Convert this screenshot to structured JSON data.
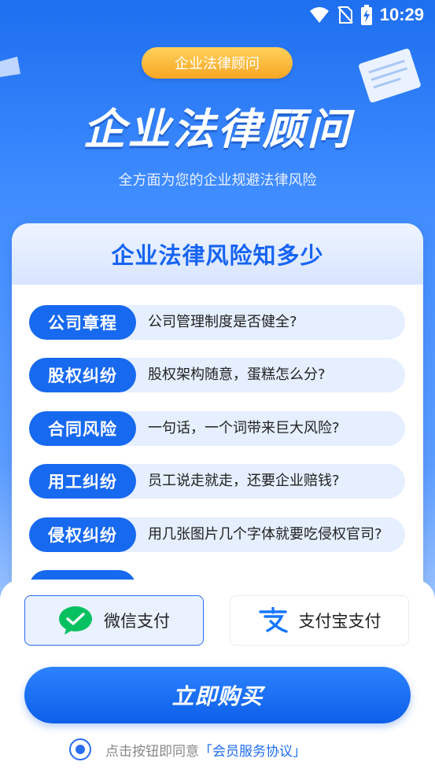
{
  "status": {
    "time": "10:29"
  },
  "header": {
    "tag": "企业法律顾问",
    "title": "企业法律顾问",
    "subtitle": "全方面为您的企业规避法律风险"
  },
  "card": {
    "title": "企业法律风险知多少",
    "items": [
      {
        "tag": "公司章程",
        "question": "公司管理制度是否健全?"
      },
      {
        "tag": "股权纠纷",
        "question": "股权架构随意，蛋糕怎么分?"
      },
      {
        "tag": "合同风险",
        "question": "一句话，一个词带来巨大风险?"
      },
      {
        "tag": "用工纠纷",
        "question": "员工说走就走，还要企业赔钱?"
      },
      {
        "tag": "侵权纠纷",
        "question": "用几张图片几个字体就要吃侵权官司?"
      }
    ]
  },
  "payment": {
    "wechat_label": "微信支付",
    "alipay_label": "支付宝支付",
    "selected": "wechat",
    "buy_label": "立即购买",
    "agree_text": "点击按钮即同意",
    "agree_link": "「会员服务协议」"
  },
  "colors": {
    "primary": "#1769ef",
    "accent": "#f7a623",
    "wechat": "#07c160",
    "alipay": "#1677ff"
  }
}
